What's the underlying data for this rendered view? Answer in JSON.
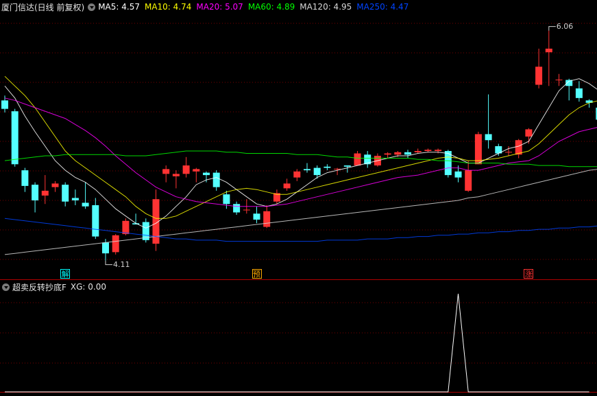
{
  "header": {
    "title": "厦门信达(日线 前复权)",
    "ma": [
      {
        "label": "MA5: 4.57",
        "color": "#ffffff"
      },
      {
        "label": "MA10: 4.74",
        "color": "#ffff00"
      },
      {
        "label": "MA20: 5.07",
        "color": "#ff00ff"
      },
      {
        "label": "MA60: 4.89",
        "color": "#00ff00"
      },
      {
        "label": "MA120: 4.95",
        "color": "#d8d8d8"
      },
      {
        "label": "MA250: 4.47",
        "color": "#0044ff"
      }
    ]
  },
  "indicator": {
    "title": "超卖反转抄底F",
    "xg_label": "XG: 0.00",
    "xg_values": [
      0,
      0,
      0,
      0,
      0,
      0,
      0,
      0,
      0,
      0,
      0,
      0,
      0,
      0,
      0,
      0,
      0,
      0,
      0,
      0,
      0,
      0,
      0,
      0,
      0,
      0,
      0,
      0,
      0,
      0,
      0,
      0,
      0,
      0,
      0,
      0,
      0,
      0,
      0,
      0,
      0,
      0,
      0,
      0,
      0,
      1,
      0,
      0,
      0,
      0,
      0,
      0,
      0,
      0,
      0,
      0,
      0,
      0,
      0
    ]
  },
  "markers": [
    {
      "label": "解",
      "index": 6,
      "color": "#00ffff"
    },
    {
      "label": "预",
      "index": 25,
      "color": "#ffaa00"
    },
    {
      "label": "涨",
      "index": 52,
      "color": "#ff3333"
    }
  ],
  "price_labels": {
    "low": "4.11",
    "high": "6.06"
  },
  "colors": {
    "up": "#ff3333",
    "down": "#54ffff",
    "grid": "#7a0000",
    "axis": "#b00000"
  },
  "chart_data": {
    "type": "candlestick",
    "ylim": [
      4.0,
      6.2
    ],
    "candles": [
      [
        5.48,
        5.41,
        5.52,
        5.38
      ],
      [
        5.39,
        4.95,
        5.41,
        4.93
      ],
      [
        4.9,
        4.77,
        4.92,
        4.72
      ],
      [
        4.78,
        4.65,
        4.8,
        4.55
      ],
      [
        4.69,
        4.73,
        4.86,
        4.62
      ],
      [
        4.76,
        4.79,
        4.81,
        4.72
      ],
      [
        4.78,
        4.64,
        4.8,
        4.6
      ],
      [
        4.67,
        4.65,
        4.74,
        4.61
      ],
      [
        4.63,
        4.6,
        4.8,
        4.58
      ],
      [
        4.61,
        4.35,
        4.67,
        4.33
      ],
      [
        4.3,
        4.21,
        4.33,
        4.15
      ],
      [
        4.22,
        4.36,
        4.37,
        4.2
      ],
      [
        4.37,
        4.48,
        4.5,
        4.36
      ],
      [
        4.46,
        4.45,
        4.54,
        4.46
      ],
      [
        4.47,
        4.32,
        4.5,
        4.3
      ],
      [
        4.29,
        4.66,
        4.74,
        4.23
      ],
      [
        4.87,
        4.91,
        4.94,
        4.8
      ],
      [
        4.85,
        4.87,
        4.9,
        4.75
      ],
      [
        4.87,
        4.94,
        5.01,
        4.84
      ],
      [
        4.89,
        4.91,
        4.92,
        4.8
      ],
      [
        4.88,
        4.86,
        4.89,
        4.8
      ],
      [
        4.88,
        4.76,
        4.9,
        4.73
      ],
      [
        4.7,
        4.62,
        4.73,
        4.58
      ],
      [
        4.62,
        4.55,
        4.64,
        4.53
      ],
      [
        4.57,
        4.57,
        4.66,
        4.54
      ],
      [
        4.54,
        4.49,
        4.6,
        4.46
      ],
      [
        4.43,
        4.56,
        4.61,
        4.42
      ],
      [
        4.64,
        4.71,
        4.74,
        4.62
      ],
      [
        4.75,
        4.79,
        4.83,
        4.73
      ],
      [
        4.84,
        4.89,
        4.91,
        4.81
      ],
      [
        4.91,
        4.9,
        4.96,
        4.88
      ],
      [
        4.92,
        4.86,
        4.94,
        4.83
      ],
      [
        4.93,
        4.92,
        4.95,
        4.9
      ],
      [
        4.91,
        4.91,
        4.92,
        4.86
      ],
      [
        4.94,
        4.93,
        4.94,
        4.88
      ],
      [
        4.94,
        5.04,
        5.06,
        4.95
      ],
      [
        5.03,
        4.95,
        5.06,
        4.92
      ],
      [
        4.94,
        5.02,
        5.04,
        4.93
      ],
      [
        5.03,
        5.04,
        5.05,
        5.0
      ],
      [
        5.03,
        5.05,
        5.06,
        5.01
      ],
      [
        5.05,
        5.03,
        5.07,
        5.0
      ],
      [
        5.05,
        5.06,
        5.08,
        5.04
      ],
      [
        5.06,
        5.07,
        5.08,
        5.05
      ],
      [
        5.06,
        5.07,
        5.08,
        5.04
      ],
      [
        5.06,
        4.86,
        5.07,
        4.84
      ],
      [
        4.89,
        4.84,
        4.94,
        4.8
      ],
      [
        4.73,
        4.9,
        4.98,
        4.72
      ],
      [
        4.95,
        5.2,
        5.22,
        4.95
      ],
      [
        5.2,
        5.15,
        5.53,
        5.08
      ],
      [
        5.1,
        5.04,
        5.12,
        5.02
      ],
      [
        5.05,
        5.05,
        5.1,
        5.02
      ],
      [
        5.03,
        5.15,
        5.16,
        5.0
      ],
      [
        5.18,
        5.24,
        5.25,
        5.12
      ],
      [
        5.61,
        5.76,
        5.91,
        5.58
      ],
      [
        5.88,
        5.91,
        6.06,
        5.6
      ],
      [
        5.65,
        5.65,
        5.7,
        5.6
      ],
      [
        5.65,
        5.6,
        5.66,
        5.48
      ],
      [
        5.58,
        5.5,
        5.64,
        5.47
      ],
      [
        5.48,
        5.46,
        5.49,
        5.42
      ],
      [
        5.42,
        5.32,
        5.45,
        5.28
      ]
    ],
    "ma_series": [
      {
        "name": "MA5",
        "values": [
          5.6,
          5.5,
          5.35,
          5.22,
          5.1,
          4.98,
          4.9,
          4.84,
          4.8,
          4.74,
          4.66,
          4.58,
          4.52,
          4.46,
          4.42,
          4.46,
          4.52,
          4.6,
          4.68,
          4.78,
          4.82,
          4.84,
          4.8,
          4.74,
          4.68,
          4.62,
          4.6,
          4.62,
          4.66,
          4.72,
          4.78,
          4.84,
          4.88,
          4.9,
          4.92,
          4.94,
          4.96,
          4.98,
          5.0,
          5.02,
          5.02,
          5.04,
          5.05,
          5.05,
          5.04,
          5.0,
          4.96,
          4.96,
          5.0,
          5.04,
          5.08,
          5.1,
          5.14,
          5.28,
          5.42,
          5.56,
          5.64,
          5.66,
          5.62,
          5.56
        ]
      },
      {
        "name": "MA10",
        "values": [
          5.68,
          5.6,
          5.52,
          5.42,
          5.3,
          5.18,
          5.06,
          4.98,
          4.92,
          4.86,
          4.8,
          4.74,
          4.68,
          4.6,
          4.54,
          4.5,
          4.5,
          4.52,
          4.56,
          4.6,
          4.64,
          4.68,
          4.72,
          4.74,
          4.75,
          4.74,
          4.72,
          4.7,
          4.7,
          4.72,
          4.74,
          4.76,
          4.78,
          4.8,
          4.82,
          4.84,
          4.86,
          4.88,
          4.9,
          4.92,
          4.94,
          4.96,
          4.98,
          5.0,
          5.01,
          5.0,
          4.98,
          4.98,
          4.99,
          5.0,
          5.02,
          5.04,
          5.06,
          5.12,
          5.2,
          5.28,
          5.36,
          5.42,
          5.46,
          5.48
        ]
      },
      {
        "name": "MA20",
        "values": [
          5.5,
          5.48,
          5.45,
          5.42,
          5.39,
          5.36,
          5.33,
          5.28,
          5.23,
          5.17,
          5.1,
          5.02,
          4.95,
          4.88,
          4.82,
          4.76,
          4.72,
          4.68,
          4.66,
          4.64,
          4.63,
          4.62,
          4.61,
          4.6,
          4.6,
          4.6,
          4.6,
          4.61,
          4.62,
          4.64,
          4.66,
          4.68,
          4.7,
          4.72,
          4.74,
          4.76,
          4.78,
          4.8,
          4.82,
          4.84,
          4.85,
          4.86,
          4.88,
          4.9,
          4.92,
          4.92,
          4.9,
          4.9,
          4.92,
          4.94,
          4.96,
          4.97,
          4.98,
          5.02,
          5.08,
          5.14,
          5.18,
          5.22,
          5.24,
          5.26
        ]
      },
      {
        "name": "MA60",
        "values": [
          4.98,
          4.99,
          5.0,
          5.01,
          5.02,
          5.02,
          5.03,
          5.03,
          5.03,
          5.03,
          5.03,
          5.03,
          5.02,
          5.02,
          5.02,
          5.03,
          5.04,
          5.05,
          5.06,
          5.06,
          5.06,
          5.06,
          5.05,
          5.05,
          5.04,
          5.04,
          5.04,
          5.04,
          5.04,
          5.03,
          5.03,
          5.03,
          5.02,
          5.01,
          5.01,
          5.0,
          5.0,
          5.0,
          5.0,
          5.0,
          5.0,
          4.99,
          4.99,
          4.98,
          4.98,
          4.97,
          4.96,
          4.96,
          4.96,
          4.96,
          4.95,
          4.95,
          4.95,
          4.94,
          4.94,
          4.94,
          4.93,
          4.93,
          4.93,
          4.93
        ]
      },
      {
        "name": "MA120",
        "values": [
          4.2,
          4.21,
          4.22,
          4.23,
          4.24,
          4.25,
          4.26,
          4.27,
          4.28,
          4.29,
          4.3,
          4.31,
          4.32,
          4.33,
          4.34,
          4.35,
          4.36,
          4.37,
          4.38,
          4.39,
          4.4,
          4.41,
          4.42,
          4.43,
          4.44,
          4.45,
          4.46,
          4.47,
          4.48,
          4.49,
          4.5,
          4.51,
          4.52,
          4.53,
          4.54,
          4.55,
          4.56,
          4.57,
          4.58,
          4.59,
          4.6,
          4.61,
          4.62,
          4.63,
          4.64,
          4.65,
          4.67,
          4.68,
          4.7,
          4.72,
          4.74,
          4.76,
          4.78,
          4.8,
          4.82,
          4.84,
          4.86,
          4.88,
          4.9,
          4.91
        ]
      },
      {
        "name": "MA250",
        "values": [
          4.5,
          4.49,
          4.48,
          4.47,
          4.46,
          4.45,
          4.44,
          4.43,
          4.42,
          4.41,
          4.4,
          4.39,
          4.38,
          4.37,
          4.36,
          4.35,
          4.34,
          4.33,
          4.33,
          4.32,
          4.32,
          4.32,
          4.31,
          4.31,
          4.31,
          4.31,
          4.31,
          4.31,
          4.31,
          4.31,
          4.31,
          4.31,
          4.32,
          4.32,
          4.32,
          4.32,
          4.33,
          4.33,
          4.33,
          4.34,
          4.34,
          4.35,
          4.35,
          4.36,
          4.36,
          4.37,
          4.37,
          4.38,
          4.38,
          4.39,
          4.39,
          4.4,
          4.4,
          4.41,
          4.41,
          4.42,
          4.42,
          4.43,
          4.43,
          4.44
        ]
      }
    ]
  }
}
